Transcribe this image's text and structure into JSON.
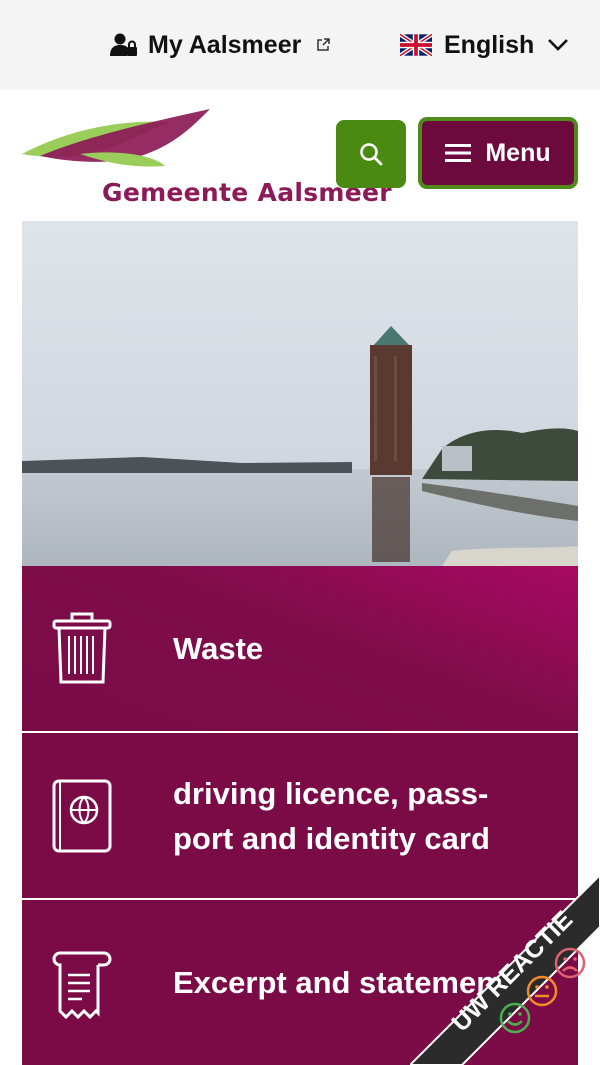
{
  "topbar": {
    "my_account_label": "My Aalsmeer",
    "language_label": "English"
  },
  "logo": {
    "text": "Gemeente Aalsmeer"
  },
  "header": {
    "menu_label": "Menu"
  },
  "tiles": [
    {
      "label": "Waste",
      "icon": "trash-bin-icon"
    },
    {
      "label": "driving licence, pass-port and identity card",
      "icon": "passport-icon"
    },
    {
      "label": "Excerpt and statemen",
      "icon": "document-scroll-icon"
    }
  ],
  "feedback": {
    "label": "UW REACTIE",
    "colors": {
      "ribbon": "#2b2b2b",
      "happy": "#4caf50",
      "neutral": "#f28c28",
      "sad": "#e06070"
    }
  },
  "colors": {
    "brand": "#7b0b47",
    "accent_green": "#4a8a12",
    "topbar_bg": "#f4f4f4"
  }
}
